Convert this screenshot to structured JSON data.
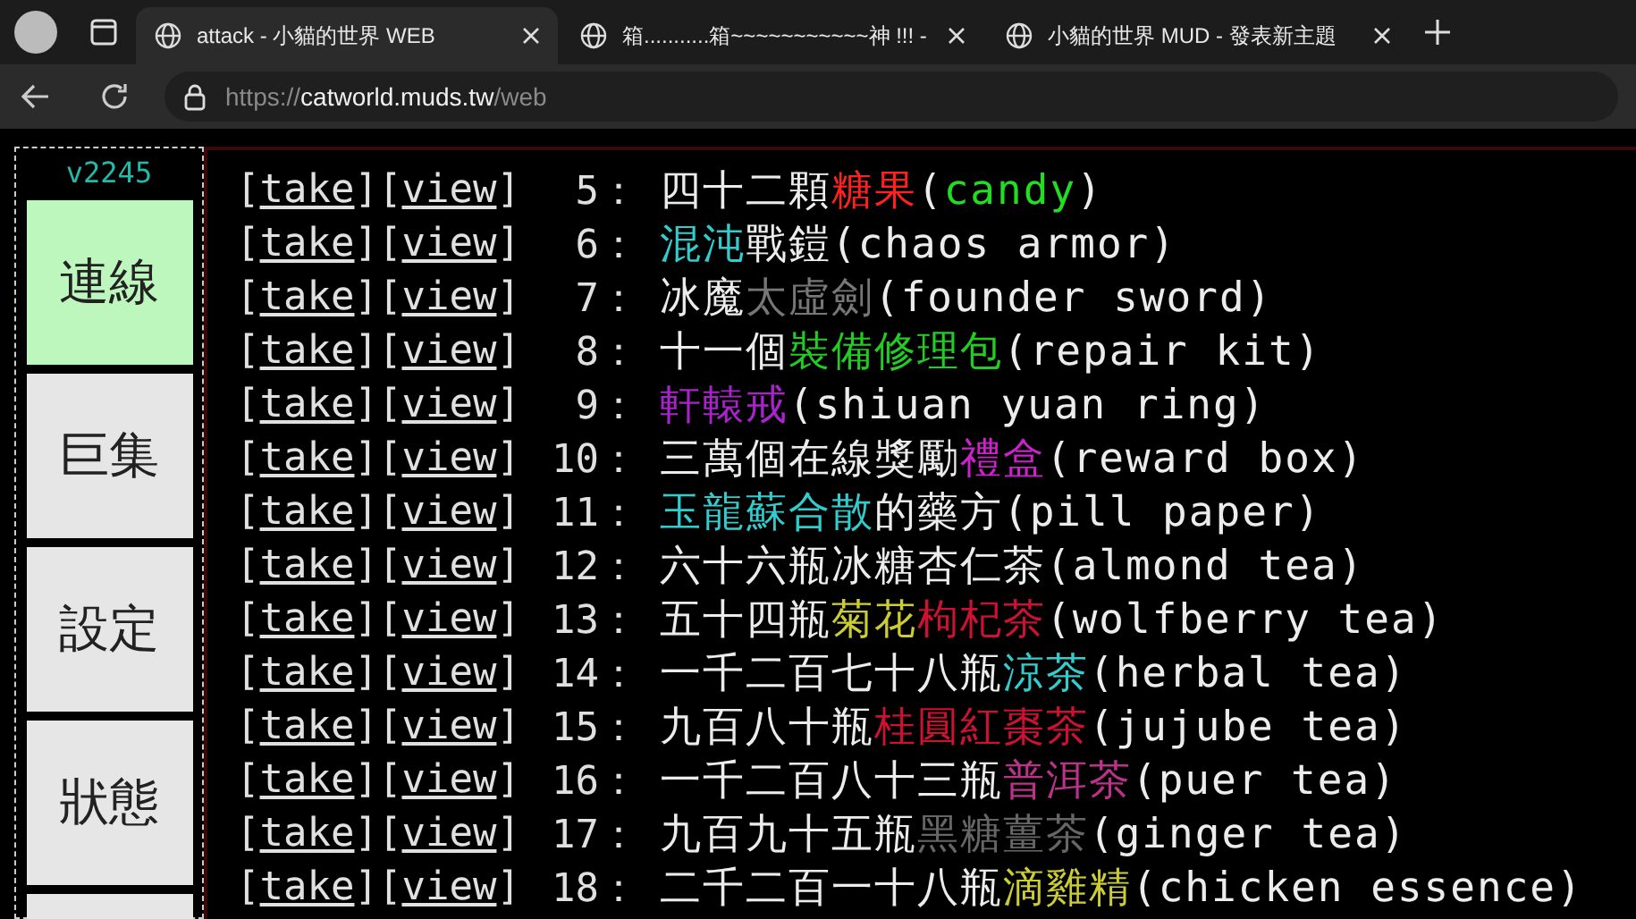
{
  "browser": {
    "tabs": [
      {
        "title": "attack - 小貓的世界 WEB",
        "selected": true
      },
      {
        "title": "箱...........箱~~~~~~~~~~~神 !!! -",
        "selected": false
      },
      {
        "title": "小貓的世界 MUD - 發表新主題",
        "selected": false
      }
    ],
    "address": {
      "scheme": "https://",
      "host": "catworld.muds.tw",
      "path": "/web"
    }
  },
  "sidebar": {
    "version": "v2245",
    "buttons": [
      {
        "label": "連線",
        "selected": true
      },
      {
        "label": "巨集",
        "selected": false
      },
      {
        "label": "設定",
        "selected": false
      },
      {
        "label": "狀態",
        "selected": false
      },
      {
        "selected": false
      }
    ]
  },
  "rows": [
    {
      "actions": [
        {
          "open": "[",
          "label": "take",
          "close": "]"
        },
        {
          "open": "[",
          "label": "view",
          "close": "]"
        }
      ],
      "number": "5",
      "colon": "：",
      "segments": [
        {
          "text": "四十二顆"
        },
        {
          "text": "糖果",
          "color": "#ff2020"
        },
        {
          "text": "("
        },
        {
          "text": "candy",
          "color": "#22dd22"
        },
        {
          "text": ")"
        }
      ]
    },
    {
      "actions": [
        {
          "open": "[",
          "label": "take",
          "close": "]"
        },
        {
          "open": "[",
          "label": "view",
          "close": "]"
        }
      ],
      "number": "6",
      "colon": "：",
      "segments": [
        {
          "text": "混沌",
          "color": "#33cccc"
        },
        {
          "text": "戰鎧(chaos armor)"
        }
      ]
    },
    {
      "actions": [
        {
          "open": "[",
          "label": "take",
          "close": "]"
        },
        {
          "open": "[",
          "label": "view",
          "close": "]"
        }
      ],
      "number": "7",
      "colon": "：",
      "segments": [
        {
          "text": "冰魔"
        },
        {
          "text": "太虛劍",
          "color": "#777777"
        },
        {
          "text": "(founder sword)"
        }
      ]
    },
    {
      "actions": [
        {
          "open": "[",
          "label": "take",
          "close": "]"
        },
        {
          "open": "[",
          "label": "view",
          "close": "]"
        }
      ],
      "number": "8",
      "colon": "：",
      "segments": [
        {
          "text": "十一個"
        },
        {
          "text": "裝備修理包",
          "color": "#22cc22"
        },
        {
          "text": "(repair kit)"
        }
      ]
    },
    {
      "actions": [
        {
          "open": "[",
          "label": "take",
          "close": "]"
        },
        {
          "open": "[",
          "label": "view",
          "close": "]"
        }
      ],
      "number": "9",
      "colon": "：",
      "segments": [
        {
          "text": "軒轅戒",
          "color": "#aa22cc"
        },
        {
          "text": "(shiuan yuan ring)"
        }
      ]
    },
    {
      "actions": [
        {
          "open": "[",
          "label": "take",
          "close": "]"
        },
        {
          "open": "[",
          "label": "view",
          "close": "]"
        }
      ],
      "number": "10",
      "colon": "：",
      "segments": [
        {
          "text": "三萬個在線獎勵"
        },
        {
          "text": "禮盒",
          "color": "#cc22cc"
        },
        {
          "text": "(reward box)"
        }
      ]
    },
    {
      "actions": [
        {
          "open": "[",
          "label": "take",
          "close": "]"
        },
        {
          "open": "[",
          "label": "view",
          "close": "]"
        }
      ],
      "number": "11",
      "colon": "：",
      "segments": [
        {
          "text": "玉龍蘇合散",
          "color": "#33cccc"
        },
        {
          "text": "的藥方(pill paper)"
        }
      ]
    },
    {
      "actions": [
        {
          "open": "[",
          "label": "take",
          "close": "]"
        },
        {
          "open": "[",
          "label": "view",
          "close": "]"
        }
      ],
      "number": "12",
      "colon": "：",
      "segments": [
        {
          "text": "六十六瓶冰糖杏仁茶(almond tea)"
        }
      ]
    },
    {
      "actions": [
        {
          "open": "[",
          "label": "take",
          "close": "]"
        },
        {
          "open": "[",
          "label": "view",
          "close": "]"
        }
      ],
      "number": "13",
      "colon": "：",
      "segments": [
        {
          "text": "五十四瓶"
        },
        {
          "text": "菊花",
          "color": "#cccc33"
        },
        {
          "text": "枸杞茶",
          "color": "#cc1133"
        },
        {
          "text": "(wolfberry tea)"
        }
      ]
    },
    {
      "actions": [
        {
          "open": "[",
          "label": "take",
          "close": "]"
        },
        {
          "open": "[",
          "label": "view",
          "close": "]"
        }
      ],
      "number": "14",
      "colon": "：",
      "segments": [
        {
          "text": "一千二百七十八瓶"
        },
        {
          "text": "涼茶",
          "color": "#33cccc"
        },
        {
          "text": "(herbal tea)"
        }
      ]
    },
    {
      "actions": [
        {
          "open": "[",
          "label": "take",
          "close": "]"
        },
        {
          "open": "[",
          "label": "view",
          "close": "]"
        }
      ],
      "number": "15",
      "colon": "：",
      "segments": [
        {
          "text": "九百八十瓶"
        },
        {
          "text": "桂圓紅棗茶",
          "color": "#cc1133"
        },
        {
          "text": "(jujube tea)"
        }
      ]
    },
    {
      "actions": [
        {
          "open": "[",
          "label": "take",
          "close": "]"
        },
        {
          "open": "[",
          "label": "view",
          "close": "]"
        }
      ],
      "number": "16",
      "colon": "：",
      "segments": [
        {
          "text": "一千二百八十三瓶"
        },
        {
          "text": "普洱茶",
          "color": "#bb3388"
        },
        {
          "text": "(puer tea)"
        }
      ]
    },
    {
      "actions": [
        {
          "open": "[",
          "label": "take",
          "close": "]"
        },
        {
          "open": "[",
          "label": "view",
          "close": "]"
        }
      ],
      "number": "17",
      "colon": "：",
      "segments": [
        {
          "text": "九百九十五瓶"
        },
        {
          "text": "黑糖薑茶",
          "color": "#666666"
        },
        {
          "text": "(ginger tea)"
        }
      ]
    },
    {
      "actions": [
        {
          "open": "[",
          "label": "take",
          "close": "]"
        },
        {
          "open": "[",
          "label": "view",
          "close": "]"
        }
      ],
      "number": "18",
      "colon": "：",
      "segments": [
        {
          "text": "二千二百一十八瓶"
        },
        {
          "text": "滴雞精",
          "color": "#cccc33"
        },
        {
          "text": "(chicken essence)"
        }
      ]
    }
  ]
}
